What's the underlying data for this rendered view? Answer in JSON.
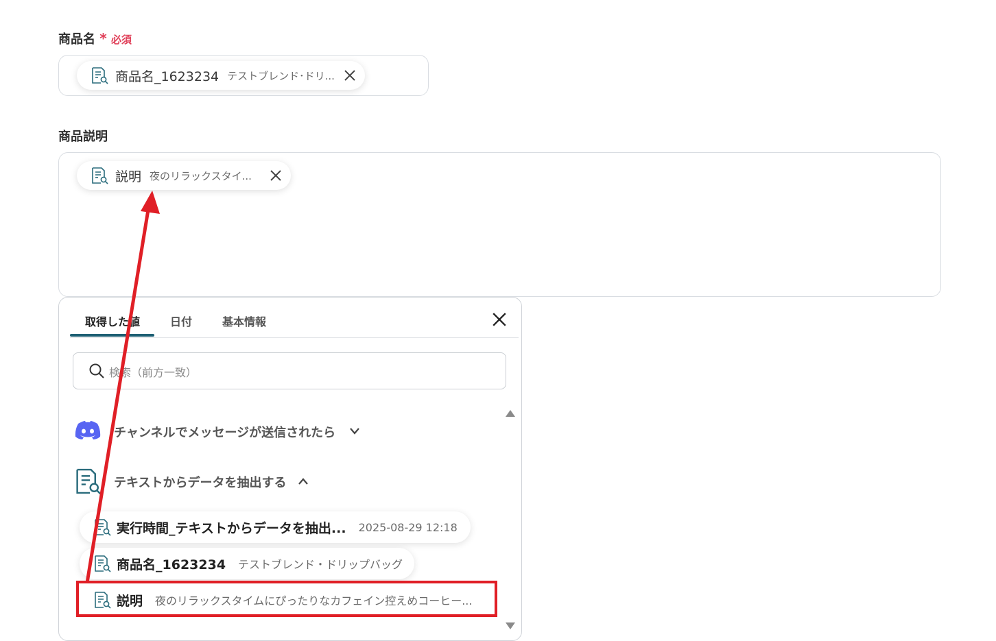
{
  "field1": {
    "label": "商品名",
    "required_star": "*",
    "required_text": "必須",
    "chip": {
      "name": "商品名_1623234",
      "value": "テストブレンド･ドリ..."
    }
  },
  "field2": {
    "label": "商品説明",
    "chip": {
      "name": "説明",
      "value": "夜のリラックスタイ..."
    }
  },
  "panel": {
    "tabs": [
      {
        "label": "取得した値",
        "active": true
      },
      {
        "label": "日付",
        "active": false
      },
      {
        "label": "基本情報",
        "active": false
      }
    ],
    "search_placeholder": "検索（前方一致）",
    "groups": [
      {
        "title": "チャンネルでメッセージが送信されたら",
        "icon": "discord-icon",
        "expanded": false
      },
      {
        "title": "テキストからデータを抽出する",
        "icon": "document-search-icon",
        "expanded": true
      }
    ],
    "items": [
      {
        "name": "実行時間_テキストからデータを抽出...",
        "value": "2025-08-29 12:18"
      },
      {
        "name": "商品名_1623234",
        "value": "テストブレンド・ドリップバッグ"
      },
      {
        "name": "説明",
        "value": "夜のリラックスタイムにぴったりなカフェイン控えめコーヒー..."
      }
    ]
  },
  "colors": {
    "accent": "#1d5f73",
    "required": "#e0415a",
    "highlight": "#e01f26",
    "discord": "#5865f2"
  }
}
